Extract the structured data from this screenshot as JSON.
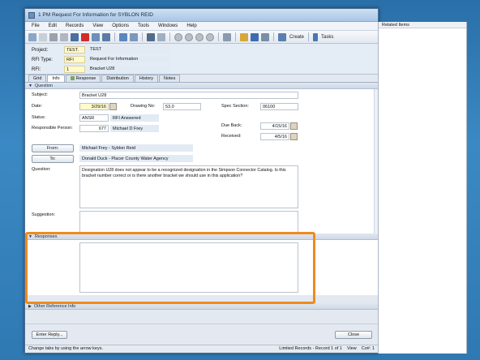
{
  "window": {
    "title": "1 PM Request For Information for SYBLON REID"
  },
  "menu": [
    "File",
    "Edit",
    "Records",
    "View",
    "Options",
    "Tools",
    "Windows",
    "Help"
  ],
  "toolbar": {
    "create_label": "Create",
    "tasks_label": "Tasks"
  },
  "header": {
    "project_label": "Project:",
    "project_code": "TEST.",
    "project_name": "TEST",
    "rfi_type_label": "RFI Type:",
    "rfi_type_code": "RFI",
    "rfi_type_name": "Request For Information",
    "rfi_label": "RFI:",
    "rfi_number": "1",
    "rfi_name": "Bracket U28"
  },
  "tabs": [
    "Grid",
    "Info",
    "Response",
    "Distribution",
    "History",
    "Notes"
  ],
  "question_section": {
    "title": "Question",
    "subject_label": "Subject:",
    "subject_value": "Bracket U28",
    "date_label": "Date:",
    "date_value": "3/29/16",
    "drawing_label": "Drawing No:",
    "drawing_value": "53.0",
    "spec_label": "Spec Section:",
    "spec_value": "06100",
    "status_label": "Status:",
    "status_code": "ANSR",
    "status_name": "RFI Answered",
    "resp_person_label": "Responsible Person:",
    "resp_person_id": "677",
    "resp_person_name": "Michael D Frey",
    "due_back_label": "Due Back:",
    "due_back_value": "4/15/16",
    "received_label": "Received:",
    "received_value": "4/5/16",
    "from_button": "From:",
    "from_value": "Michael Frey - Syblon Reid",
    "to_button": "To:",
    "to_value": "Donald Duck - Placer County Water Agency",
    "question_label": "Question:",
    "question_text": "Designation U28 does not appear to be a recognized designation in the Simpson Connector Catalog.  Is this bracket number correct or is there another bracket we should use in this application?",
    "suggestion_label": "Suggestion:"
  },
  "responses_section": {
    "title": "Responses"
  },
  "other_section": {
    "title": "Other Reference Info"
  },
  "footer": {
    "enter_reply": "Enter Reply...",
    "close": "Close"
  },
  "status_bar": {
    "hint": "Change tabs by using the arrow keys.",
    "records": "Limited Records - Record 1 of 1",
    "view": "View",
    "co": "Co#: 1"
  },
  "related": {
    "title": "Related Items"
  },
  "colors": {
    "highlight": "#f08a1c",
    "required_field": "#fff9cc"
  }
}
